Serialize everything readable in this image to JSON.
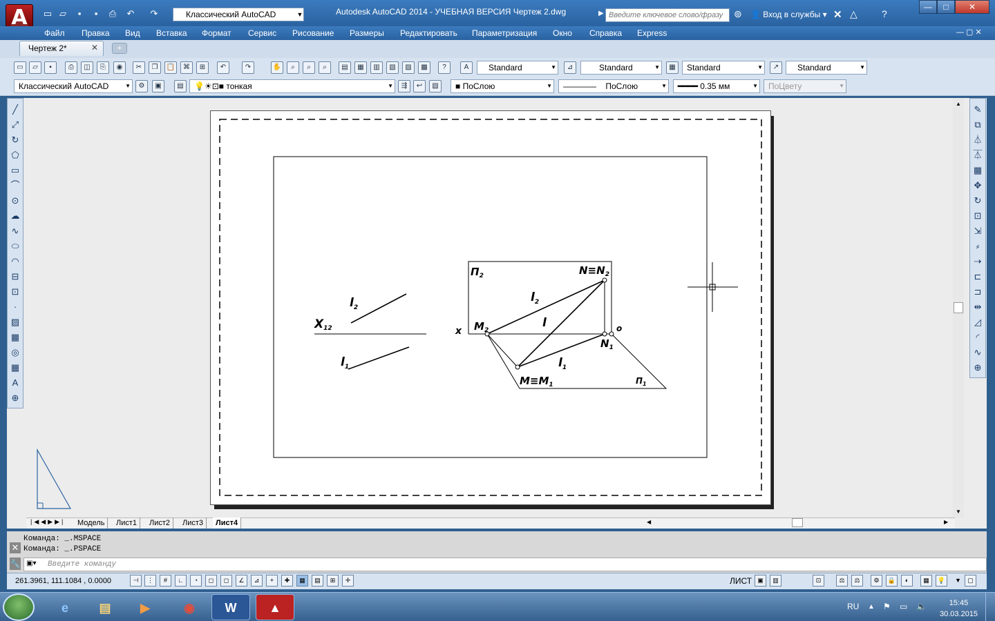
{
  "title": {
    "workspace": "Классический AutoCAD",
    "window_title": "Autodesk AutoCAD 2014 - УЧЕБНАЯ ВЕРСИЯ      Чертеж 2.dwg",
    "search_placeholder": "Введите ключевое слово/фразу",
    "login": "Вход в службы"
  },
  "menu": [
    "Файл",
    "Правка",
    "Вид",
    "Вставка",
    "Формат",
    "Сервис",
    "Рисование",
    "Размеры",
    "Редактировать",
    "Параметризация",
    "Окно",
    "Справка",
    "Express"
  ],
  "doc_tab": "Чертеж 2*",
  "styles": {
    "text_style": "Standard",
    "dim_style": "Standard",
    "table_style": "Standard",
    "mleader_style": "Standard"
  },
  "props": {
    "workspace": "Классический AutoCAD",
    "layer": "тонкая",
    "color": "ПоСлою",
    "linetype": "ПоСлою",
    "lineweight": "0.35 мм",
    "plotstyle": "ПоЦвету"
  },
  "drawing": {
    "pi2": "П",
    "pi2_sub": "2",
    "n_eq_n2": "N≡N",
    "n2_sub": "2",
    "l2": "l",
    "l2_sub": "2",
    "l": "l",
    "l1": "l",
    "l1_sub": "1",
    "m2": "M",
    "m2_sub": "2",
    "x": "x",
    "o": "o",
    "n1": "N",
    "n1_sub": "1",
    "m_eq_m1": "M≡M",
    "m1_sub": "1",
    "pi1": "П",
    "pi1_sub": "1",
    "x12": "X",
    "x12_sub": "12",
    "left_l2": "l",
    "left_l2_sub": "2",
    "left_l1": "l",
    "left_l1_sub": "1"
  },
  "layout_tabs": [
    "Модель",
    "Лист1",
    "Лист2",
    "Лист3",
    "Лист4"
  ],
  "command": {
    "history": [
      "Команда:  _.MSPACE",
      "Команда:  _.PSPACE"
    ],
    "placeholder": "Введите команду"
  },
  "status": {
    "coords": "261.3961, 111.1084 , 0.0000",
    "space": "ЛИСТ"
  },
  "tray": {
    "lang": "RU",
    "time": "15:45",
    "date": "30.03.2015"
  }
}
